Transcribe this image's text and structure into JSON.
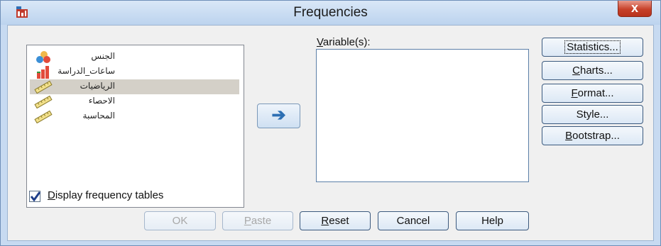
{
  "window": {
    "title": "Frequencies",
    "close_symbol": "x"
  },
  "source_list": {
    "items": [
      {
        "label": "الجنس",
        "icon": "nominal-icon"
      },
      {
        "label": "ساعات_الدراسة",
        "icon": "ordinal-icon"
      },
      {
        "label": "الرياضيات",
        "icon": "scale-icon",
        "selected": true
      },
      {
        "label": "الاحصاء",
        "icon": "scale-icon"
      },
      {
        "label": "المحاسبة",
        "icon": "scale-icon"
      }
    ]
  },
  "move_button": {
    "icon": "arrow-right-icon",
    "symbol": "➔"
  },
  "variables": {
    "label_accel": "V",
    "label_rest": "ariable(s):"
  },
  "side_buttons": {
    "statistics": "Statistics...",
    "charts_accel": "C",
    "charts_rest": "harts...",
    "format_accel": "F",
    "format_rest": "ormat...",
    "style": "Style...",
    "bootstrap_accel": "B",
    "bootstrap_rest": "ootstrap..."
  },
  "display_freq": {
    "checked": true,
    "accel": "D",
    "rest": "isplay frequency tables"
  },
  "bottom_buttons": {
    "ok": "OK",
    "paste_accel": "P",
    "paste_rest": "aste",
    "reset_accel": "R",
    "reset_rest": "eset",
    "cancel": "Cancel",
    "help": "Help"
  },
  "colors": {
    "accent": "#2d6fb3",
    "titlebar": "#bcd3ee",
    "close": "#c7412a"
  }
}
